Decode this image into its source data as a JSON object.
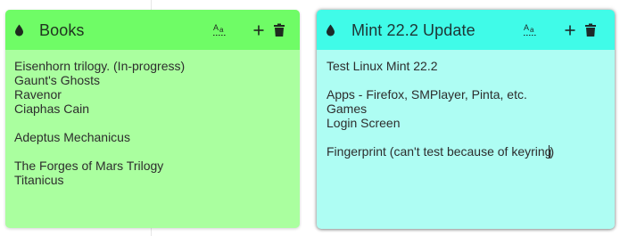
{
  "desktop": {
    "notes": [
      {
        "id": "books",
        "title": "Books",
        "color": "#aaff9f",
        "header_color": "#6ffc66",
        "icons": {
          "title_icon": "water-drop-icon",
          "font_button": "text-size-icon",
          "add_button": "plus-icon",
          "delete_button": "trash-icon"
        },
        "content": "Eisenhorn trilogy. (In-progress)\nGaunt's Ghosts\nRavenor\nCiaphas Cain\n\nAdeptus Mechanicus\n\nThe Forges of Mars Trilogy\nTitanicus"
      },
      {
        "id": "mint",
        "title": "Mint 22.2 Update",
        "color": "#aefdf3",
        "header_color": "#40fbe8",
        "icons": {
          "title_icon": "water-drop-icon",
          "font_button": "text-size-icon",
          "add_button": "plus-icon",
          "delete_button": "trash-icon"
        },
        "content_before_caret": "Test Linux Mint 22.2\n\nApps - Firefox, SMPlayer, Pinta, etc.\nGames\nLogin Screen\n\nFingerprint (can't test because of keyring",
        "content_after_caret": ")"
      }
    ]
  }
}
